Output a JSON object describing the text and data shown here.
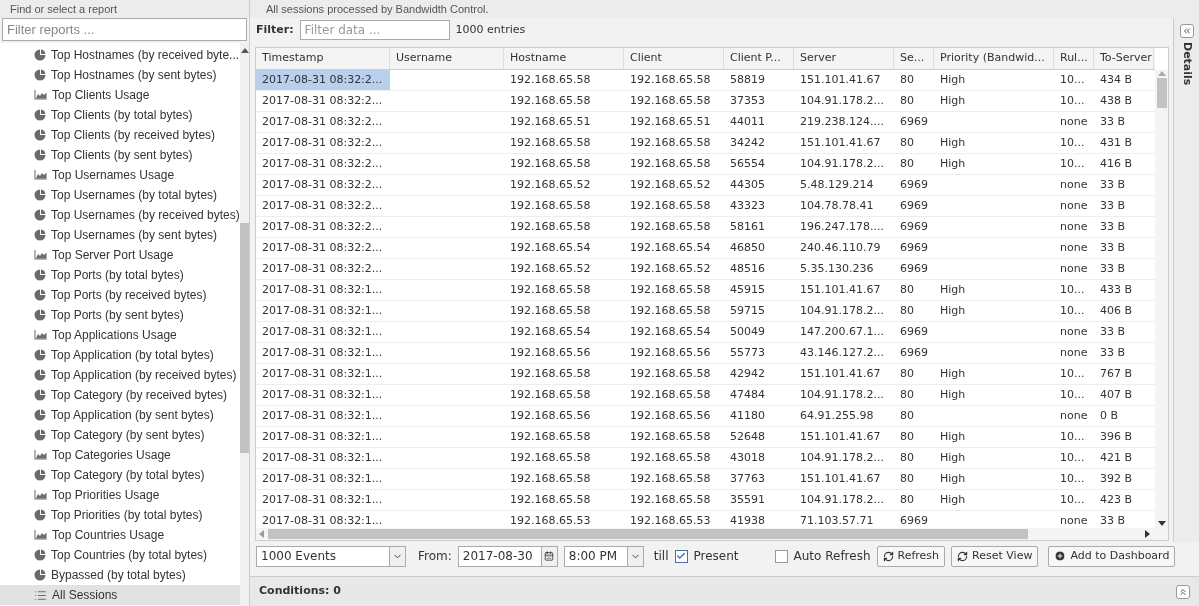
{
  "sidebar": {
    "title": "Find or select a report",
    "filter": {
      "placeholder": "Filter reports ..."
    },
    "items": [
      {
        "label": "Top Hostnames (by received byte...",
        "kind": "pie",
        "selected": false
      },
      {
        "label": "Top Hostnames (by sent bytes)",
        "kind": "pie",
        "selected": false
      },
      {
        "label": "Top Clients Usage",
        "kind": "area",
        "selected": false
      },
      {
        "label": "Top Clients (by total bytes)",
        "kind": "pie",
        "selected": false
      },
      {
        "label": "Top Clients (by received bytes)",
        "kind": "pie",
        "selected": false
      },
      {
        "label": "Top Clients (by sent bytes)",
        "kind": "pie",
        "selected": false
      },
      {
        "label": "Top Usernames Usage",
        "kind": "area",
        "selected": false
      },
      {
        "label": "Top Usernames (by total bytes)",
        "kind": "pie",
        "selected": false
      },
      {
        "label": "Top Usernames (by received bytes)",
        "kind": "pie",
        "selected": false
      },
      {
        "label": "Top Usernames (by sent bytes)",
        "kind": "pie",
        "selected": false
      },
      {
        "label": "Top Server Port Usage",
        "kind": "area",
        "selected": false
      },
      {
        "label": "Top Ports (by total bytes)",
        "kind": "pie",
        "selected": false
      },
      {
        "label": "Top Ports (by received bytes)",
        "kind": "pie",
        "selected": false
      },
      {
        "label": "Top Ports (by sent bytes)",
        "kind": "pie",
        "selected": false
      },
      {
        "label": "Top Applications Usage",
        "kind": "area",
        "selected": false
      },
      {
        "label": "Top Application (by total bytes)",
        "kind": "pie",
        "selected": false
      },
      {
        "label": "Top Application (by received bytes)",
        "kind": "pie",
        "selected": false
      },
      {
        "label": "Top Category (by received bytes)",
        "kind": "pie",
        "selected": false
      },
      {
        "label": "Top Application (by sent bytes)",
        "kind": "pie",
        "selected": false
      },
      {
        "label": "Top Category (by sent bytes)",
        "kind": "pie",
        "selected": false
      },
      {
        "label": "Top Categories Usage",
        "kind": "area",
        "selected": false
      },
      {
        "label": "Top Category (by total bytes)",
        "kind": "pie",
        "selected": false
      },
      {
        "label": "Top Priorities Usage",
        "kind": "area",
        "selected": false
      },
      {
        "label": "Top Priorities (by total bytes)",
        "kind": "pie",
        "selected": false
      },
      {
        "label": "Top Countries Usage",
        "kind": "area",
        "selected": false
      },
      {
        "label": "Top Countries (by total bytes)",
        "kind": "pie",
        "selected": false
      },
      {
        "label": "Bypassed (by total bytes)",
        "kind": "pie",
        "selected": false
      },
      {
        "label": "All Sessions",
        "kind": "list",
        "selected": true
      }
    ]
  },
  "report_title": "All sessions processed by Bandwidth Control.",
  "filter_bar": {
    "label": "Filter:",
    "placeholder": "Filter data ...",
    "count": "1000 entries"
  },
  "table": {
    "columns": [
      "Timestamp",
      "Username",
      "Hostname",
      "Client",
      "Client P...",
      "Server",
      "Se...",
      "Priority (Bandwid...",
      "Rul...",
      "To-Server"
    ],
    "rows": [
      {
        "selected": true,
        "cells": [
          "2017-08-31 08:32:2...",
          "",
          "192.168.65.58",
          "192.168.65.58",
          "58819",
          "151.101.41.67",
          "80",
          "High",
          "10...",
          "434 B"
        ]
      },
      {
        "selected": false,
        "cells": [
          "2017-08-31 08:32:2...",
          "",
          "192.168.65.58",
          "192.168.65.58",
          "37353",
          "104.91.178.2...",
          "80",
          "High",
          "10...",
          "438 B"
        ]
      },
      {
        "selected": false,
        "cells": [
          "2017-08-31 08:32:2...",
          "",
          "192.168.65.51",
          "192.168.65.51",
          "44011",
          "219.238.124....",
          "6969",
          "",
          "none",
          "33 B"
        ]
      },
      {
        "selected": false,
        "cells": [
          "2017-08-31 08:32:2...",
          "",
          "192.168.65.58",
          "192.168.65.58",
          "34242",
          "151.101.41.67",
          "80",
          "High",
          "10...",
          "431 B"
        ]
      },
      {
        "selected": false,
        "cells": [
          "2017-08-31 08:32:2...",
          "",
          "192.168.65.58",
          "192.168.65.58",
          "56554",
          "104.91.178.2...",
          "80",
          "High",
          "10...",
          "416 B"
        ]
      },
      {
        "selected": false,
        "cells": [
          "2017-08-31 08:32:2...",
          "",
          "192.168.65.52",
          "192.168.65.52",
          "44305",
          "5.48.129.214",
          "6969",
          "",
          "none",
          "33 B"
        ]
      },
      {
        "selected": false,
        "cells": [
          "2017-08-31 08:32:2...",
          "",
          "192.168.65.58",
          "192.168.65.58",
          "43323",
          "104.78.78.41",
          "6969",
          "",
          "none",
          "33 B"
        ]
      },
      {
        "selected": false,
        "cells": [
          "2017-08-31 08:32:2...",
          "",
          "192.168.65.58",
          "192.168.65.58",
          "58161",
          "196.247.178....",
          "6969",
          "",
          "none",
          "33 B"
        ]
      },
      {
        "selected": false,
        "cells": [
          "2017-08-31 08:32:2...",
          "",
          "192.168.65.54",
          "192.168.65.54",
          "46850",
          "240.46.110.79",
          "6969",
          "",
          "none",
          "33 B"
        ]
      },
      {
        "selected": false,
        "cells": [
          "2017-08-31 08:32:2...",
          "",
          "192.168.65.52",
          "192.168.65.52",
          "48516",
          "5.35.130.236",
          "6969",
          "",
          "none",
          "33 B"
        ]
      },
      {
        "selected": false,
        "cells": [
          "2017-08-31 08:32:1...",
          "",
          "192.168.65.58",
          "192.168.65.58",
          "45915",
          "151.101.41.67",
          "80",
          "High",
          "10...",
          "433 B"
        ]
      },
      {
        "selected": false,
        "cells": [
          "2017-08-31 08:32:1...",
          "",
          "192.168.65.58",
          "192.168.65.58",
          "59715",
          "104.91.178.2...",
          "80",
          "High",
          "10...",
          "406 B"
        ]
      },
      {
        "selected": false,
        "cells": [
          "2017-08-31 08:32:1...",
          "",
          "192.168.65.54",
          "192.168.65.54",
          "50049",
          "147.200.67.1...",
          "6969",
          "",
          "none",
          "33 B"
        ]
      },
      {
        "selected": false,
        "cells": [
          "2017-08-31 08:32:1...",
          "",
          "192.168.65.56",
          "192.168.65.56",
          "55773",
          "43.146.127.2...",
          "6969",
          "",
          "none",
          "33 B"
        ]
      },
      {
        "selected": false,
        "cells": [
          "2017-08-31 08:32:1...",
          "",
          "192.168.65.58",
          "192.168.65.58",
          "42942",
          "151.101.41.67",
          "80",
          "High",
          "10...",
          "767 B"
        ]
      },
      {
        "selected": false,
        "cells": [
          "2017-08-31 08:32:1...",
          "",
          "192.168.65.58",
          "192.168.65.58",
          "47484",
          "104.91.178.2...",
          "80",
          "High",
          "10...",
          "407 B"
        ]
      },
      {
        "selected": false,
        "cells": [
          "2017-08-31 08:32:1...",
          "",
          "192.168.65.56",
          "192.168.65.56",
          "41180",
          "64.91.255.98",
          "80",
          "",
          "none",
          "0 B"
        ]
      },
      {
        "selected": false,
        "cells": [
          "2017-08-31 08:32:1...",
          "",
          "192.168.65.58",
          "192.168.65.58",
          "52648",
          "151.101.41.67",
          "80",
          "High",
          "10...",
          "396 B"
        ]
      },
      {
        "selected": false,
        "cells": [
          "2017-08-31 08:32:1...",
          "",
          "192.168.65.58",
          "192.168.65.58",
          "43018",
          "104.91.178.2...",
          "80",
          "High",
          "10...",
          "421 B"
        ]
      },
      {
        "selected": false,
        "cells": [
          "2017-08-31 08:32:1...",
          "",
          "192.168.65.58",
          "192.168.65.58",
          "37763",
          "151.101.41.67",
          "80",
          "High",
          "10...",
          "392 B"
        ]
      },
      {
        "selected": false,
        "cells": [
          "2017-08-31 08:32:1...",
          "",
          "192.168.65.58",
          "192.168.65.58",
          "35591",
          "104.91.178.2...",
          "80",
          "High",
          "10...",
          "423 B"
        ]
      },
      {
        "selected": false,
        "cells": [
          "2017-08-31 08:32:1...",
          "",
          "192.168.65.53",
          "192.168.65.53",
          "41938",
          "71.103.57.71",
          "6969",
          "",
          "none",
          "33 B"
        ]
      }
    ]
  },
  "details_tab": "Details",
  "toolbar": {
    "events": "1000 Events",
    "from_label": "From:",
    "date": "2017-08-30",
    "time": "8:00 PM",
    "till_label": "till",
    "present": {
      "label": "Present",
      "checked": true
    },
    "auto_refresh": {
      "label": "Auto Refresh",
      "checked": false
    },
    "buttons": [
      {
        "label": "Refresh",
        "kind": "refresh"
      },
      {
        "label": "Reset View",
        "kind": "refresh"
      },
      {
        "label": "Add to Dashboard",
        "kind": "add"
      }
    ]
  },
  "conditions": "Conditions: 0"
}
